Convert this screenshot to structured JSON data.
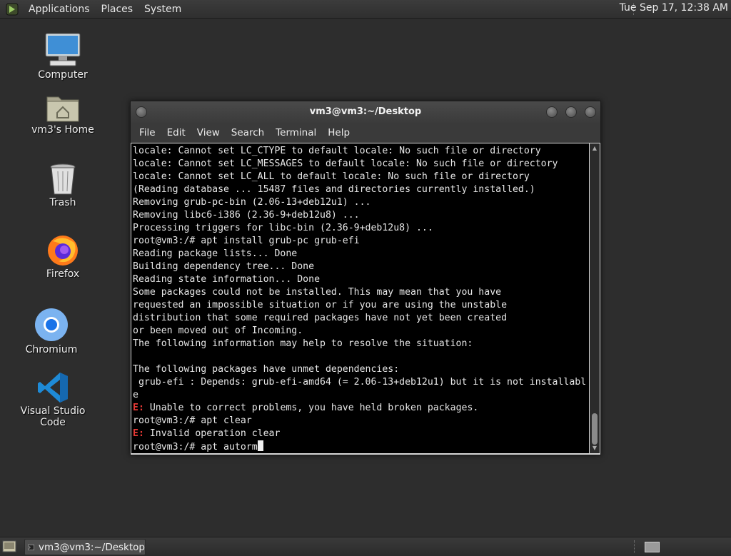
{
  "top_panel": {
    "menus": [
      "Applications",
      "Places",
      "System"
    ],
    "clock": "Tue Sep 17, 12:38 AM"
  },
  "desktop_icons": [
    {
      "label": "Computer",
      "icon": "computer-icon"
    },
    {
      "label": "vm3's Home",
      "icon": "home-folder-icon"
    },
    {
      "label": "Trash",
      "icon": "trash-icon"
    },
    {
      "label": "Firefox",
      "icon": "firefox-icon"
    },
    {
      "label": "Chromium",
      "icon": "chromium-icon"
    },
    {
      "label": "Visual Studio Code",
      "icon": "vscode-icon"
    }
  ],
  "terminal": {
    "title": "vm3@vm3:~/Desktop",
    "menus": [
      "File",
      "Edit",
      "View",
      "Search",
      "Terminal",
      "Help"
    ],
    "lines": [
      "locale: Cannot set LC_CTYPE to default locale: No such file or directory",
      "locale: Cannot set LC_MESSAGES to default locale: No such file or directory",
      "locale: Cannot set LC_ALL to default locale: No such file or directory",
      "(Reading database ... 15487 files and directories currently installed.)",
      "Removing grub-pc-bin (2.06-13+deb12u1) ...",
      "Removing libc6-i386 (2.36-9+deb12u8) ...",
      "Processing triggers for libc-bin (2.36-9+deb12u8) ...",
      "root@vm3:/# apt install grub-pc grub-efi",
      "Reading package lists... Done",
      "Building dependency tree... Done",
      "Reading state information... Done",
      "Some packages could not be installed. This may mean that you have",
      "requested an impossible situation or if you are using the unstable",
      "distribution that some required packages have not yet been created",
      "or been moved out of Incoming.",
      "The following information may help to resolve the situation:",
      "",
      "The following packages have unmet dependencies:",
      " grub-efi : Depends: grub-efi-amd64 (= 2.06-13+deb12u1) but it is not installabl",
      "e",
      "E: Unable to correct problems, you have held broken packages.",
      "root@vm3:/# apt clear",
      "E: Invalid operation clear",
      "root@vm3:/# apt autorm"
    ]
  },
  "taskbar": {
    "window_label": "vm3@vm3:~/Desktop"
  },
  "colors": {
    "desktop_bg": "#2d2d2d",
    "terminal_bg": "#000000",
    "error_tag": "#e53935"
  }
}
